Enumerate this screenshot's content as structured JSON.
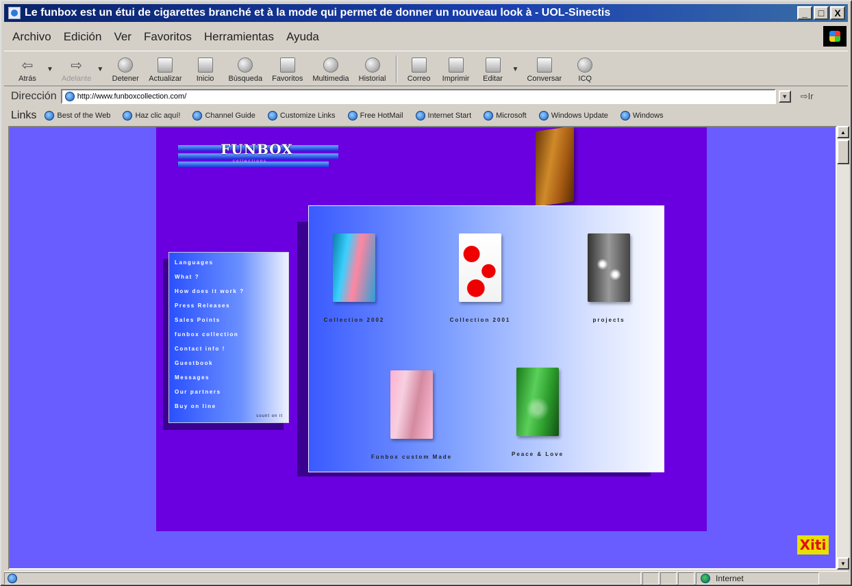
{
  "window": {
    "title": "Le funbox est un étui de cigarettes branché et à la mode qui permet de donner un nouveau look à - UOL-Sinectis",
    "minimize": "_",
    "maximize": "□",
    "close": "X"
  },
  "menubar": {
    "items": [
      "Archivo",
      "Edición",
      "Ver",
      "Favoritos",
      "Herramientas",
      "Ayuda"
    ]
  },
  "toolbar": {
    "back": "Atrás",
    "forward": "Adelante",
    "stop": "Detener",
    "refresh": "Actualizar",
    "home": "Inicio",
    "search": "Búsqueda",
    "favorites": "Favoritos",
    "media": "Multimedia",
    "history": "Historial",
    "mail": "Correo",
    "print": "Imprimir",
    "edit": "Editar",
    "discuss": "Conversar",
    "icq": "ICQ"
  },
  "address": {
    "label": "Dirección",
    "url": "http://www.funboxcollection.com/",
    "go": "Ir"
  },
  "links": {
    "label": "Links",
    "items": [
      "Best of the Web",
      "Haz clic aquí!",
      "Channel Guide",
      "Customize Links",
      "Free HotMail",
      "Internet Start",
      "Microsoft",
      "Windows Update",
      "Windows"
    ]
  },
  "site": {
    "logo": "FUNBOX",
    "logo_sub": "collections",
    "menu": [
      "Languages",
      "What ?",
      "How does it work ?",
      "Press Releases",
      "Sales Points",
      "funbox collection",
      "Contact info !",
      "Guestbook",
      "Messages",
      "Our partners",
      "Buy on line"
    ],
    "menu_footer": "count on it",
    "gallery": [
      {
        "caption": "Collection 2002"
      },
      {
        "caption": "Collection 2001"
      },
      {
        "caption": "projects"
      },
      {
        "caption": "Funbox custom Made"
      },
      {
        "caption": "Peace & Love"
      }
    ],
    "badge": "Xiti"
  },
  "status": {
    "zone": "Internet"
  }
}
